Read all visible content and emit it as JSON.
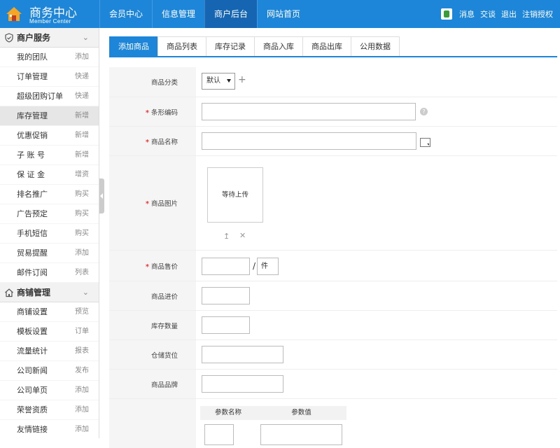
{
  "header": {
    "title": "商务中心",
    "subtitle": "Member Center",
    "nav": [
      "会员中心",
      "信息管理",
      "商户后台",
      "网站首页"
    ],
    "nav_active": 2,
    "right_links": [
      "消息",
      "交谈",
      "退出",
      "注销授权"
    ]
  },
  "sidebar": {
    "sections": [
      {
        "title": "商户服务",
        "icon": "shield-icon",
        "items": [
          {
            "label": "我的团队",
            "tag": "添加"
          },
          {
            "label": "订单管理",
            "tag": "快递"
          },
          {
            "label": "超级团购订单",
            "tag": "快递"
          },
          {
            "label": "库存管理",
            "tag": "新增",
            "active": true
          },
          {
            "label": "优惠促销",
            "tag": "新增"
          },
          {
            "label": "子 账 号",
            "tag": "新增"
          },
          {
            "label": "保 证 金",
            "tag": "增资"
          },
          {
            "label": "排名推广",
            "tag": "购买"
          },
          {
            "label": "广告预定",
            "tag": "购买"
          },
          {
            "label": "手机短信",
            "tag": "购买"
          },
          {
            "label": "贸易提醒",
            "tag": "添加"
          },
          {
            "label": "邮件订阅",
            "tag": "列表"
          }
        ]
      },
      {
        "title": "商铺管理",
        "icon": "home-icon",
        "items": [
          {
            "label": "商铺设置",
            "tag": "预览"
          },
          {
            "label": "模板设置",
            "tag": "订单"
          },
          {
            "label": "流量统计",
            "tag": "报表"
          },
          {
            "label": "公司新闻",
            "tag": "发布"
          },
          {
            "label": "公司单页",
            "tag": "添加"
          },
          {
            "label": "荣誉资质",
            "tag": "添加"
          },
          {
            "label": "友情链接",
            "tag": "添加"
          }
        ]
      }
    ]
  },
  "tabs": [
    "添加商品",
    "商品列表",
    "库存记录",
    "商品入库",
    "商品出库",
    "公用数据"
  ],
  "tab_active": 0,
  "form": {
    "category": {
      "label": "商品分类",
      "value": "默认"
    },
    "barcode": {
      "label": "条形编码",
      "required": true
    },
    "name": {
      "label": "商品名称",
      "required": true
    },
    "image": {
      "label": "商品图片",
      "required": true,
      "placeholder": "等待上传"
    },
    "price": {
      "label": "商品售价",
      "required": true,
      "unit": "件",
      "separator": "/"
    },
    "cost": {
      "label": "商品进价"
    },
    "stock": {
      "label": "库存数量"
    },
    "location": {
      "label": "仓储货位"
    },
    "brand": {
      "label": "商品品牌"
    },
    "params": {
      "header_name": "参数名称",
      "header_value": "参数值"
    }
  },
  "colors": {
    "primary": "#1e86d9",
    "nav_active": "#1565b3",
    "label_bg": "#f5f5f5",
    "required": "#e33333"
  }
}
